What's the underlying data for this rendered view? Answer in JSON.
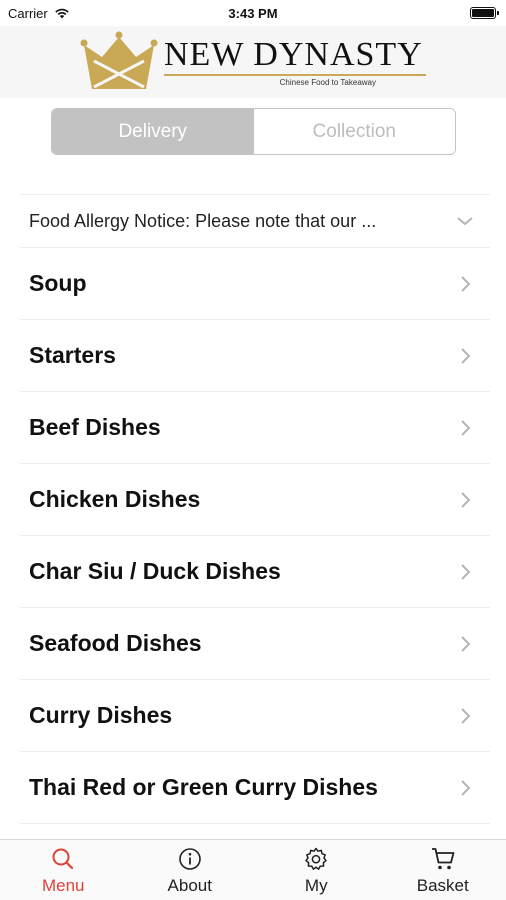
{
  "status_bar": {
    "carrier": "Carrier",
    "time": "3:43 PM"
  },
  "header": {
    "brand_name": "NEW DYNASTY",
    "tagline": "Chinese Food to Takeaway",
    "logo_icon": "crown-logo-icon",
    "brand_color": "#c9a955"
  },
  "order_mode": {
    "options": [
      "Delivery",
      "Collection"
    ],
    "selected": "Delivery"
  },
  "notice": {
    "text": "Food Allergy Notice: Please note that our ...",
    "icon": "chevron-down-icon"
  },
  "categories": [
    {
      "label": "Soup"
    },
    {
      "label": "Starters"
    },
    {
      "label": "Beef Dishes"
    },
    {
      "label": "Chicken Dishes"
    },
    {
      "label": "Char Siu / Duck Dishes"
    },
    {
      "label": "Seafood Dishes"
    },
    {
      "label": "Curry Dishes"
    },
    {
      "label": "Thai Red or Green Curry Dishes"
    }
  ],
  "tab_bar": {
    "tabs": [
      {
        "label": "Menu",
        "icon": "search-icon",
        "active": true
      },
      {
        "label": "About",
        "icon": "info-icon",
        "active": false
      },
      {
        "label": "My",
        "icon": "gear-icon",
        "active": false
      },
      {
        "label": "Basket",
        "icon": "cart-icon",
        "active": false
      }
    ],
    "active_color": "#e0403b"
  }
}
